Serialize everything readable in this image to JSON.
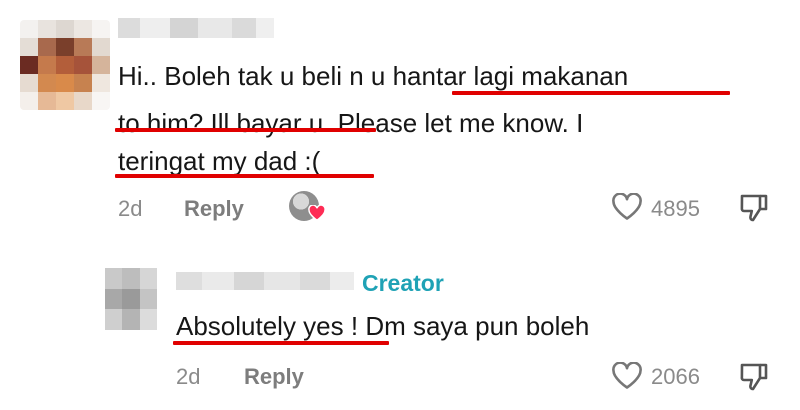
{
  "comment": {
    "lines": [
      "Hi.. Boleh tak u beli n u hantar lagi makanan",
      "to him? Ill bayar u. Please let me know. I",
      "teringat my dad :("
    ],
    "time": "2d",
    "reply_label": "Reply",
    "likes": "4895"
  },
  "reply": {
    "badge": "Creator",
    "text": "Absolutely yes ! Dm saya pun boleh",
    "time": "2d",
    "reply_label": "Reply",
    "likes": "2066"
  },
  "colors": {
    "underline": "#e00000",
    "creator_badge": "#1fa2b5",
    "liked_heart": "#fe2c55"
  },
  "icons": [
    "heart-outline-icon",
    "dislike-icon",
    "liked-heart-badge-icon"
  ]
}
